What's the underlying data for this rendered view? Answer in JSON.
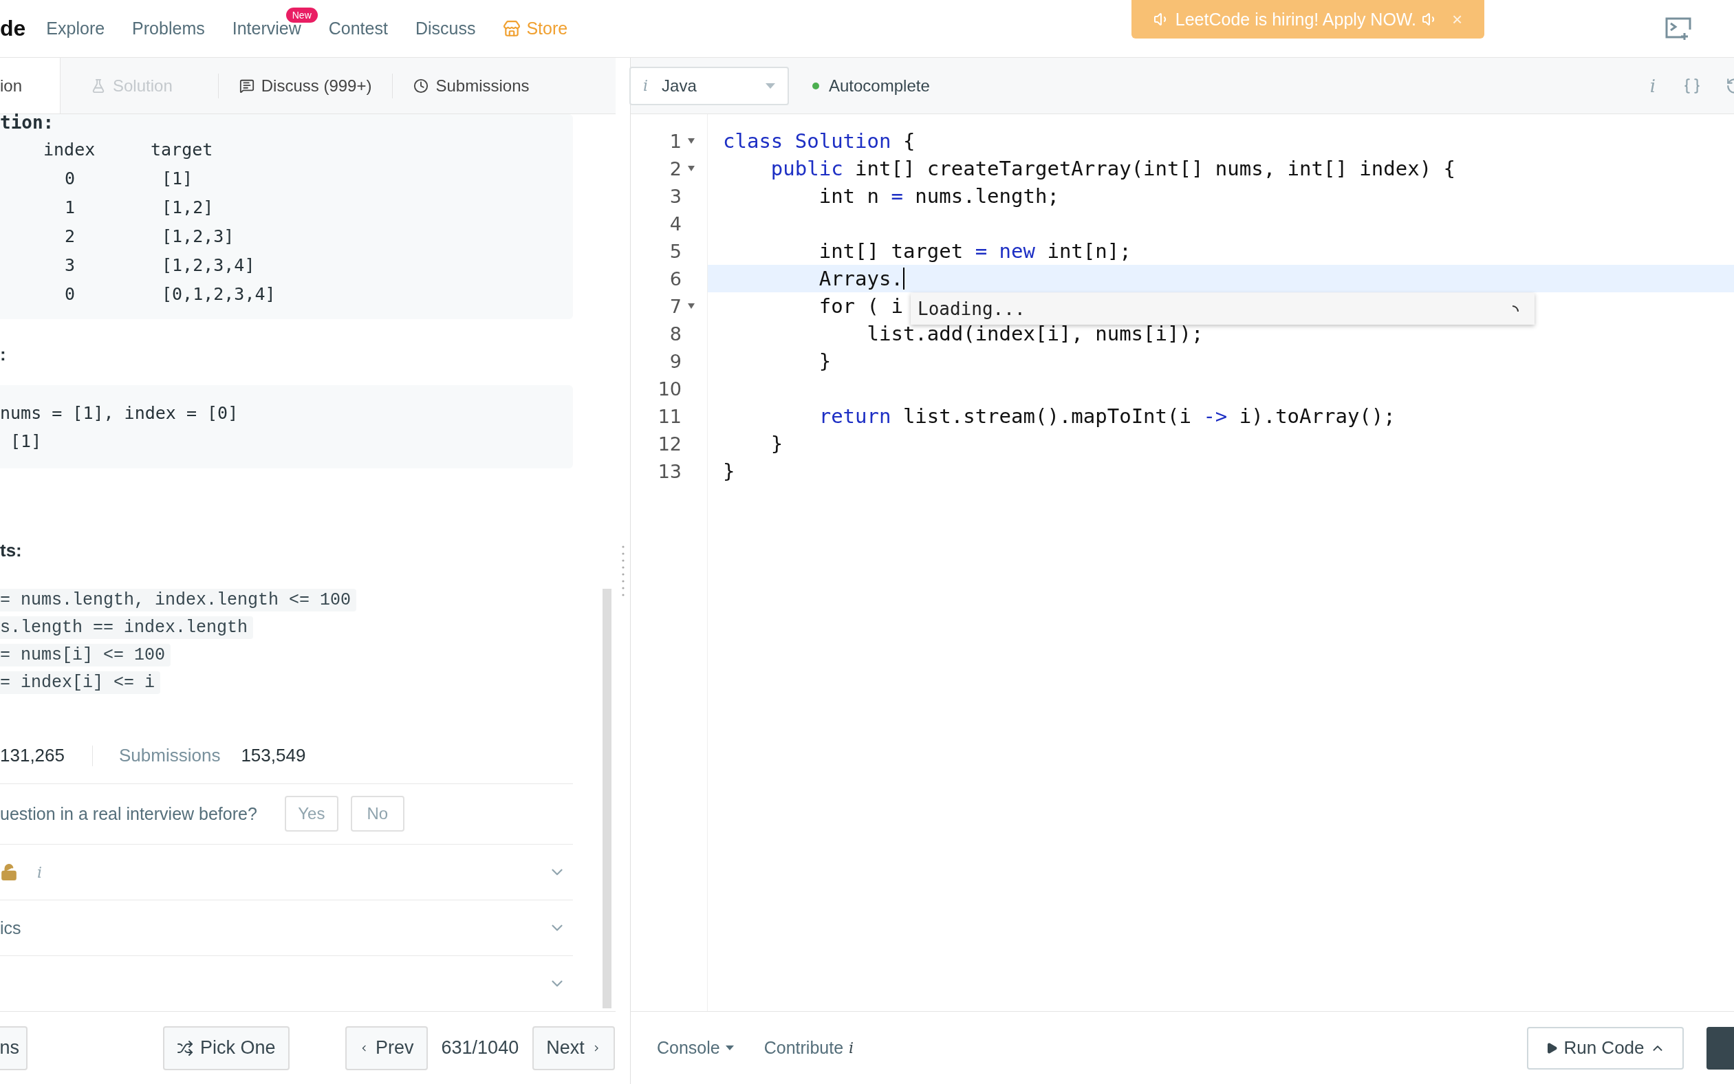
{
  "logo": "de",
  "nav": [
    {
      "label": "Explore",
      "kind": "link"
    },
    {
      "label": "Problems",
      "kind": "link"
    },
    {
      "label": "Interview",
      "kind": "link",
      "badge": "New"
    },
    {
      "label": "Contest",
      "kind": "link"
    },
    {
      "label": "Discuss",
      "kind": "link"
    },
    {
      "label": "Store",
      "kind": "store"
    }
  ],
  "banner": {
    "text": "LeetCode is hiring! Apply NOW.",
    "close": "×"
  },
  "left_tabs": [
    {
      "label": "ion",
      "kind": "description",
      "selected": true,
      "disabled": false
    },
    {
      "label": "Solution",
      "kind": "solution",
      "selected": false,
      "disabled": true
    },
    {
      "label": "Discuss (999+)",
      "kind": "discuss",
      "selected": false,
      "disabled": false
    },
    {
      "label": "Submissions",
      "kind": "submissions",
      "selected": false,
      "disabled": false
    }
  ],
  "language": {
    "info": "i",
    "value": "Java"
  },
  "autocomplete": {
    "label": "Autocomplete",
    "on": true
  },
  "toolbar_info": "i",
  "example_1": {
    "heading": "tion:",
    "columns": [
      "index",
      "target"
    ],
    "rows": [
      [
        "0",
        "[1]"
      ],
      [
        "1",
        "[1,2]"
      ],
      [
        "2",
        "[1,2,3]"
      ],
      [
        "3",
        "[1,2,3,4]"
      ],
      [
        "0",
        "[0,1,2,3,4]"
      ]
    ]
  },
  "example_2": {
    "heading": ":",
    "lines": [
      "nums = [1], index = [0]",
      " [1]"
    ]
  },
  "constraints": {
    "heading": "ts:",
    "items": [
      "= nums.length, index.length <= 100",
      "s.length == index.length",
      "= nums[i] <= 100",
      "= index[i] <= i"
    ]
  },
  "stats": {
    "accepted_value": "131,265",
    "submissions_label": "Submissions",
    "submissions_value": "153,549"
  },
  "interview": {
    "question": "uestion in a real interview before?",
    "buttons": [
      "Yes",
      "No"
    ]
  },
  "sections": [
    {
      "kind": "companies",
      "info": "i",
      "expanded": false
    },
    {
      "kind": "topics",
      "label": "ics",
      "expanded": false
    },
    {
      "kind": "similar",
      "expanded": false
    }
  ],
  "footer_left": {
    "cut_button": "ns",
    "pick": "Pick One",
    "prev": "Prev",
    "page": "631/1040",
    "next": "Next"
  },
  "editor": {
    "lines": [
      {
        "number": "1",
        "foldable": true,
        "current": false,
        "segments": [
          {
            "kind": "keyword",
            "text": "class Solution"
          },
          {
            "kind": "plain",
            "text": " {"
          }
        ]
      },
      {
        "number": "2",
        "foldable": true,
        "current": false,
        "segments": [
          {
            "kind": "keyword",
            "text": "    public"
          },
          {
            "kind": "plain",
            "text": " int[] createTargetArray(int[] nums, int[] index) {"
          }
        ]
      },
      {
        "number": "3",
        "foldable": false,
        "current": false,
        "segments": [
          {
            "kind": "plain",
            "text": "        int n "
          },
          {
            "kind": "operator",
            "text": "="
          },
          {
            "kind": "plain",
            "text": " nums.length;"
          }
        ]
      },
      {
        "number": "4",
        "foldable": false,
        "current": false
      },
      {
        "number": "5",
        "foldable": false,
        "current": false,
        "segments": [
          {
            "kind": "plain",
            "text": "        int[] target "
          },
          {
            "kind": "operator",
            "text": "="
          },
          {
            "kind": "keyword",
            "text": " new"
          },
          {
            "kind": "plain",
            "text": " int[n];"
          }
        ]
      },
      {
        "number": "6",
        "foldable": false,
        "current": true,
        "segments": [
          {
            "kind": "plain",
            "text": "        Arrays."
          }
        ]
      },
      {
        "number": "7",
        "foldable": true,
        "current": false,
        "segments": [
          {
            "kind": "plain",
            "text": "        for ( i"
          }
        ]
      },
      {
        "number": "8",
        "foldable": false,
        "current": false,
        "segments": [
          {
            "kind": "plain",
            "text": "            list.add(index[i], nums[i]);"
          }
        ]
      },
      {
        "number": "9",
        "foldable": false,
        "current": false,
        "segments": [
          {
            "kind": "plain",
            "text": "        }"
          }
        ]
      },
      {
        "number": "10",
        "foldable": false,
        "current": false
      },
      {
        "number": "11",
        "foldable": false,
        "current": false,
        "segments": [
          {
            "kind": "keyword",
            "text": "        return"
          },
          {
            "kind": "plain",
            "text": " list.stream().mapToInt(i "
          },
          {
            "kind": "operator",
            "text": "->"
          },
          {
            "kind": "plain",
            "text": " i).toArray();"
          }
        ]
      },
      {
        "number": "12",
        "foldable": false,
        "current": false,
        "segments": [
          {
            "kind": "plain",
            "text": "    }"
          }
        ]
      },
      {
        "number": "13",
        "foldable": false,
        "current": false,
        "segments": [
          {
            "kind": "plain",
            "text": "}"
          }
        ]
      }
    ],
    "popup": {
      "text": "Loading..."
    }
  },
  "console": "Console",
  "contribute": {
    "label": "Contribute",
    "info": "i"
  },
  "run": "Run Code"
}
